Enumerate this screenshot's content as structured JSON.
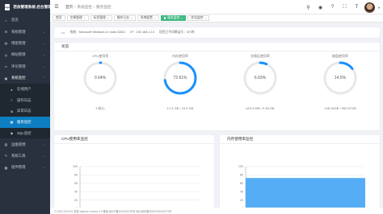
{
  "brand": {
    "logo_text": "logo",
    "title": "若依管理系统-后台管理"
  },
  "sidebar": {
    "items": [
      {
        "label": "首页",
        "icon": "home-icon"
      },
      {
        "label": "系统管理",
        "icon": "gear-icon"
      },
      {
        "label": "博客管理",
        "icon": "blog-icon"
      },
      {
        "label": "网站管理",
        "icon": "globe-icon"
      },
      {
        "label": "评论管理",
        "icon": "comment-icon"
      },
      {
        "label": "系统监控",
        "icon": "monitor-icon"
      }
    ],
    "submenu": [
      {
        "label": "在线用户",
        "icon": "user-icon"
      },
      {
        "label": "操作日志",
        "icon": "log-icon"
      },
      {
        "label": "异常日志",
        "icon": "error-log-icon"
      },
      {
        "label": "服务监控",
        "icon": "server-icon"
      },
      {
        "label": "SQL监控",
        "icon": "sql-icon"
      }
    ],
    "items_after": [
      {
        "label": "运维管理",
        "icon": "ops-icon"
      },
      {
        "label": "系统工具",
        "icon": "tool-icon"
      },
      {
        "label": "组件管理",
        "icon": "component-icon"
      }
    ]
  },
  "topbar": {
    "breadcrumbs": [
      "首页",
      "系统监控",
      "服务监控"
    ]
  },
  "tabs": [
    {
      "label": "首页",
      "active": false
    },
    {
      "label": "文章管理",
      "active": false
    },
    {
      "label": "标签管理",
      "active": false
    },
    {
      "label": "操作日志",
      "active": false
    },
    {
      "label": "系统配置",
      "active": false
    },
    {
      "label": "服务监控",
      "active": true
    },
    {
      "label": "优化监控",
      "active": false
    }
  ],
  "info": {
    "system": "系统：Microsoft Windows 11 build 22621",
    "ip": "IP：192.168.1.13",
    "uptime": "项目已不间断运行：6小时"
  },
  "status": {
    "title": "状态",
    "gauges": [
      {
        "label": "CPU使用率",
        "value_text": "0.64%",
        "percent": 0.64,
        "sub": "4 核心"
      },
      {
        "label": "内存使用率",
        "value_text": "72.61%",
        "percent": 72.61,
        "sub": "17.4 GB / 23.9 GB"
      },
      {
        "label": "交换区使用率",
        "value_text": "6.63%",
        "percent": 6.63,
        "sub": "624.9 MB / 9.38 GB"
      },
      {
        "label": "磁盘使用率",
        "value_text": "14.5%",
        "percent": 14.5,
        "sub": "138.16GB / 952.67GB"
      }
    ],
    "ring_color": "#1890ff",
    "track_color": "#e8e8e8"
  },
  "charts": {
    "cpu_title": "CPU使用率监控",
    "mem_title": "内存使用率监控"
  },
  "chart_data": [
    {
      "type": "line",
      "title": "CPU使用率监控",
      "xlabel": "",
      "ylabel": "",
      "ylim": [
        0,
        100
      ],
      "yticks": [
        0,
        20,
        40,
        60,
        80,
        100
      ],
      "series": [
        {
          "values": []
        }
      ],
      "grid": true
    },
    {
      "type": "area",
      "title": "内存使用率监控",
      "xlabel": "",
      "ylabel": "",
      "ylim": [
        0,
        100
      ],
      "yticks": [
        0,
        20,
        40,
        60,
        80,
        100
      ],
      "series": [
        {
          "values": [
            72.61,
            72.61
          ]
        }
      ],
      "color": "#55adf6",
      "grid": true
    }
  ],
  "footer": {
    "text": "© 2023-2024 BY 若依 Apache License 2.0 备案 赣ICP备2024033783号 赣公网安备36040302000179号"
  }
}
